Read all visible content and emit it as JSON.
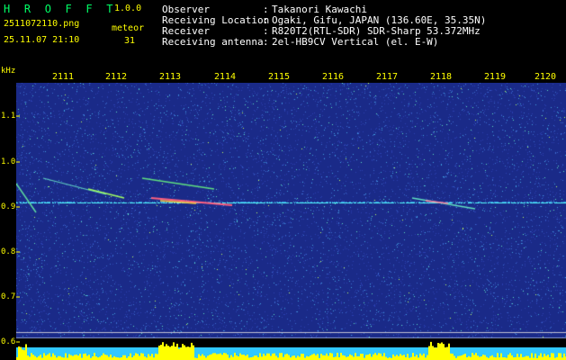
{
  "header": {
    "logo": "H R O F F T",
    "version": "1.0.0",
    "filename": "2511072110.png",
    "datetime": "25.11.07 21:10",
    "meteor_label": "meteor",
    "meteor_count": "31",
    "fields": [
      {
        "label": "Observer",
        "value": "Takanori Kawachi"
      },
      {
        "label": "Receiving Location",
        "value": "Ogaki, Gifu, JAPAN (136.60E, 35.35N)"
      },
      {
        "label": "Receiver",
        "value": "R820T2(RTL-SDR) SDR-Sharp 53.372MHz"
      },
      {
        "label": "Receiving antenna",
        "value": "2el-HB9CV Vertical (el. E-W)"
      }
    ],
    "separator": ":"
  },
  "axis": {
    "y_unit": "kHz",
    "x_ticks": [
      "2111",
      "2112",
      "2113",
      "2114",
      "2115",
      "2116",
      "2117",
      "2118",
      "2119",
      "2120"
    ],
    "y_ticks": [
      "1.1",
      "1.0",
      "0.9",
      "0.8",
      "0.7",
      "0.6"
    ]
  },
  "colors": {
    "header_green": "#00ff66",
    "text_yellow": "#ffff00",
    "text_white": "#ffffff",
    "background_blue": "#1a2a88",
    "carrier_cyan": "#55ffff"
  }
}
